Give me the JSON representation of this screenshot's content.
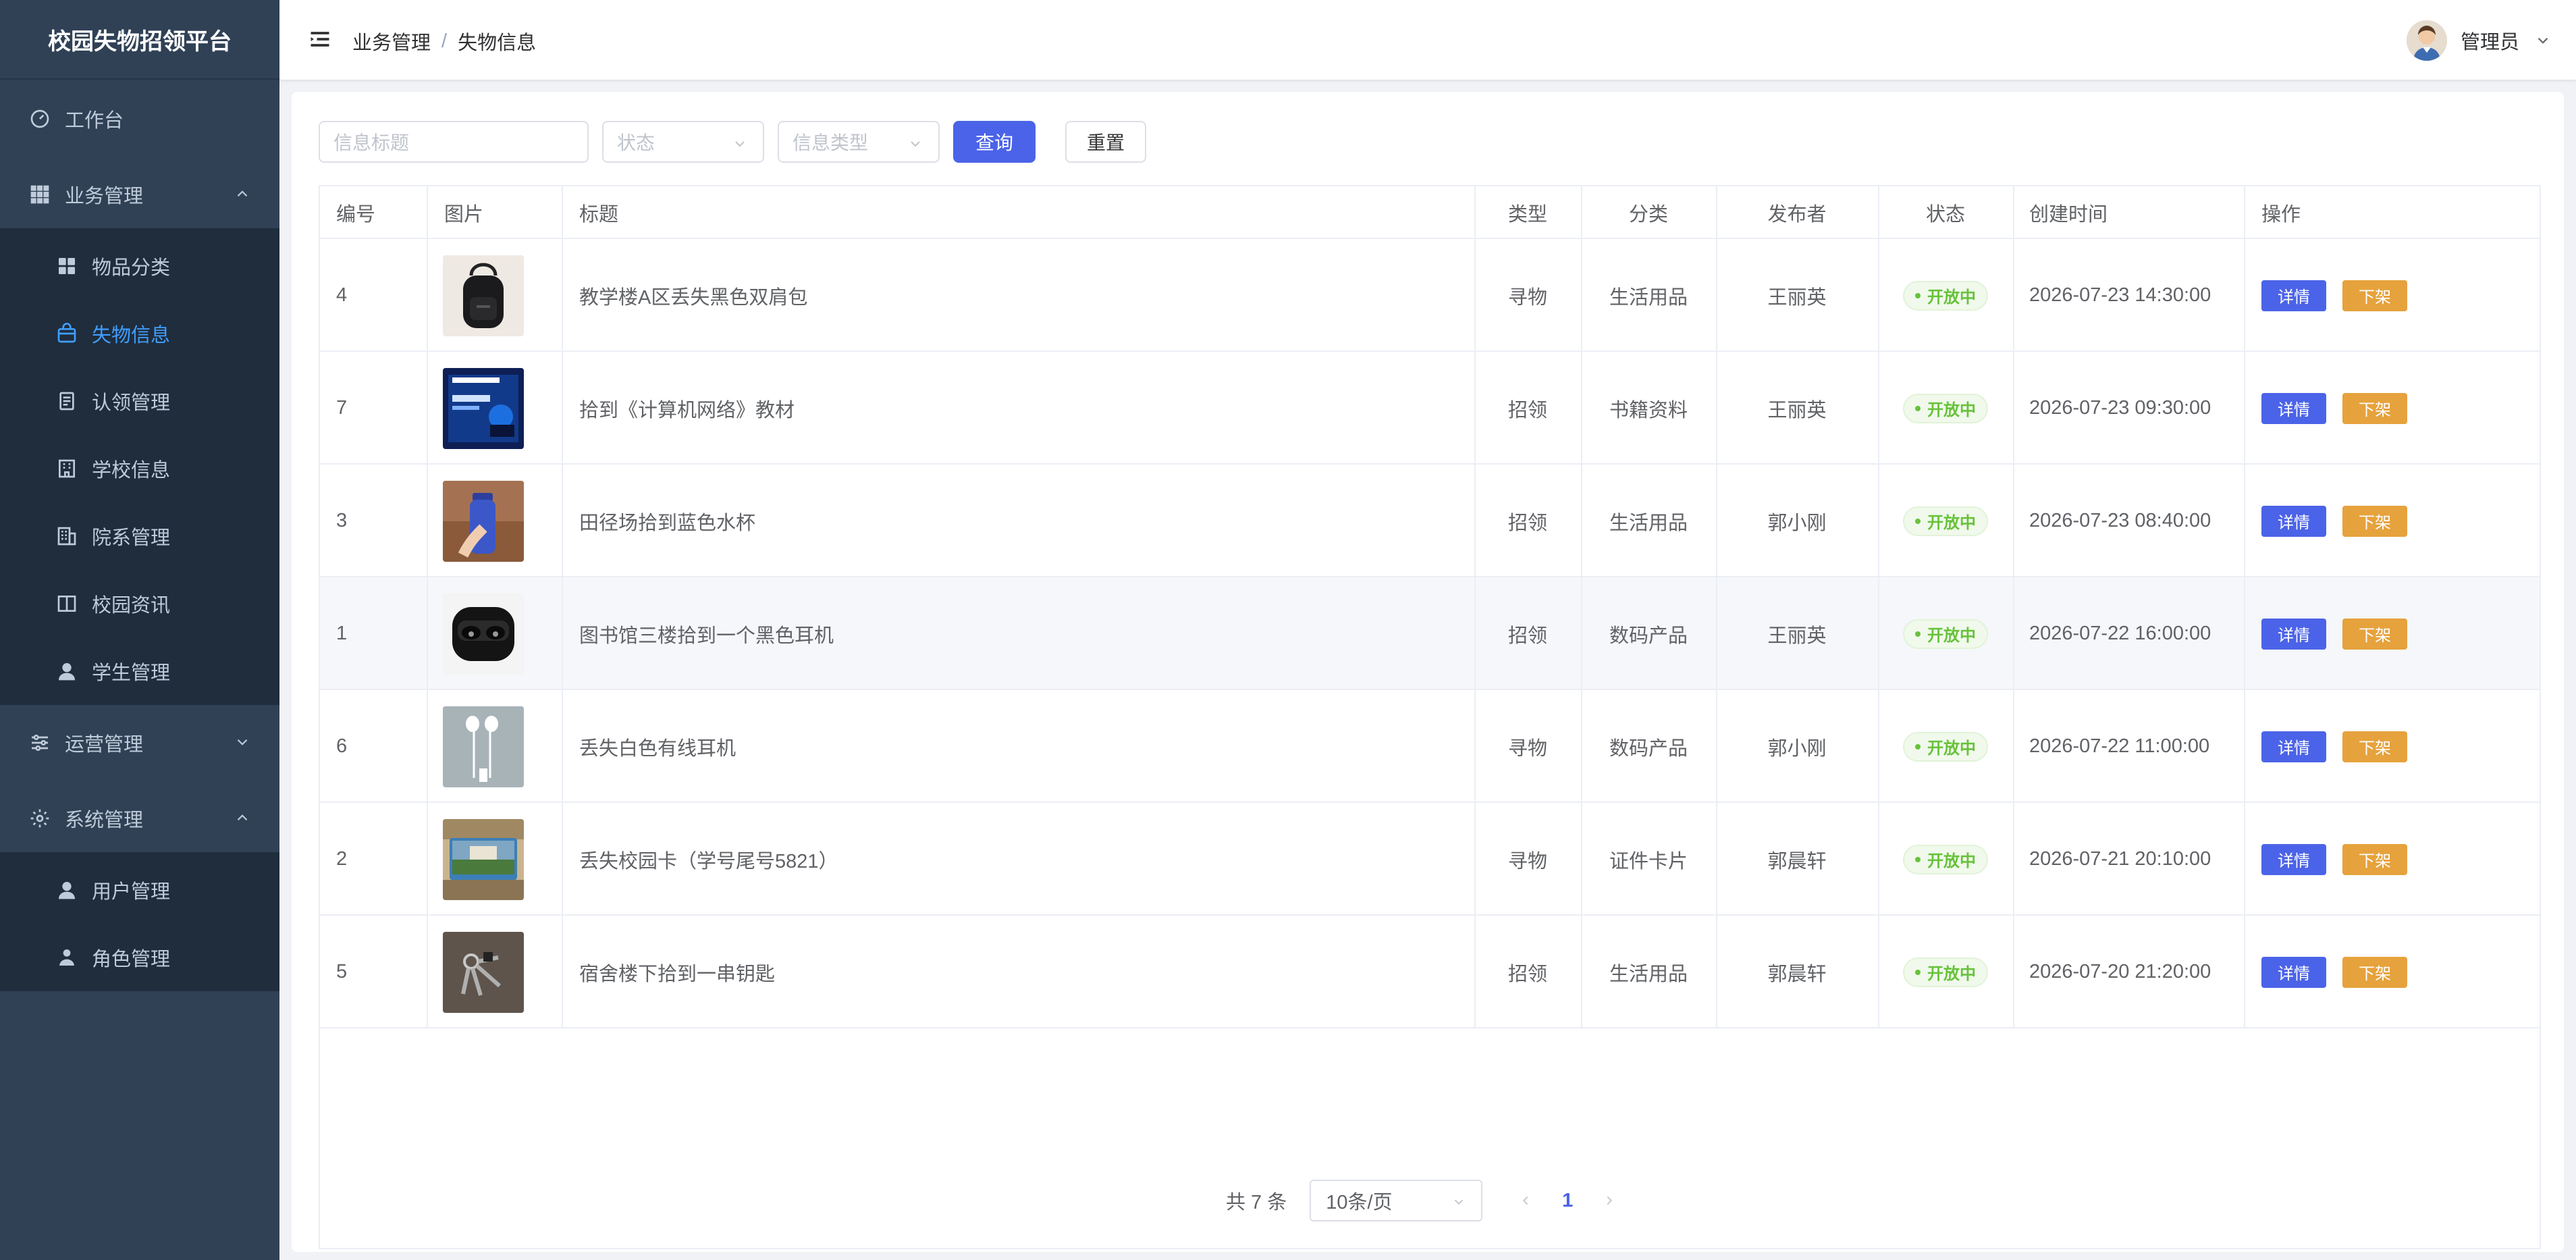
{
  "app": {
    "title": "校园失物招领平台"
  },
  "sidebar": {
    "items": [
      {
        "label": "工作台",
        "icon": "dashboard-icon"
      },
      {
        "label": "业务管理",
        "icon": "grid-icon",
        "expanded": true
      },
      {
        "label": "物品分类",
        "icon": "category-icon"
      },
      {
        "label": "失物信息",
        "icon": "bag-icon",
        "active": true
      },
      {
        "label": "认领管理",
        "icon": "document-icon"
      },
      {
        "label": "学校信息",
        "icon": "building-icon"
      },
      {
        "label": "院系管理",
        "icon": "office-icon"
      },
      {
        "label": "校园资讯",
        "icon": "book-icon"
      },
      {
        "label": "学生管理",
        "icon": "user-icon"
      },
      {
        "label": "运营管理",
        "icon": "sliders-icon",
        "expanded": false
      },
      {
        "label": "系统管理",
        "icon": "gear-icon",
        "expanded": true
      },
      {
        "label": "用户管理",
        "icon": "user-icon"
      },
      {
        "label": "角色管理",
        "icon": "user-role-icon"
      }
    ]
  },
  "header": {
    "breadcrumb": [
      "业务管理",
      "失物信息"
    ],
    "separator": "/",
    "user": "管理员"
  },
  "search": {
    "title_placeholder": "信息标题",
    "status_placeholder": "状态",
    "type_placeholder": "信息类型",
    "query_label": "查询",
    "reset_label": "重置"
  },
  "table": {
    "headers": [
      "编号",
      "图片",
      "标题",
      "类型",
      "分类",
      "发布者",
      "状态",
      "创建时间",
      "操作"
    ],
    "rows": [
      {
        "id": "4",
        "title": "教学楼A区丢失黑色双肩包",
        "type": "寻物",
        "category": "生活用品",
        "publisher": "王丽英",
        "status": "开放中",
        "created": "2026-07-23 14:30:00",
        "thumb": "backpack"
      },
      {
        "id": "7",
        "title": "拾到《计算机网络》教材",
        "type": "招领",
        "category": "书籍资料",
        "publisher": "王丽英",
        "status": "开放中",
        "created": "2026-07-23 09:30:00",
        "thumb": "book"
      },
      {
        "id": "3",
        "title": "田径场拾到蓝色水杯",
        "type": "招领",
        "category": "生活用品",
        "publisher": "郭小刚",
        "status": "开放中",
        "created": "2026-07-23 08:40:00",
        "thumb": "bottle"
      },
      {
        "id": "1",
        "title": "图书馆三楼拾到一个黑色耳机",
        "type": "招领",
        "category": "数码产品",
        "publisher": "王丽英",
        "status": "开放中",
        "created": "2026-07-22 16:00:00",
        "thumb": "earbuds"
      },
      {
        "id": "6",
        "title": "丢失白色有线耳机",
        "type": "寻物",
        "category": "数码产品",
        "publisher": "郭小刚",
        "status": "开放中",
        "created": "2026-07-22 11:00:00",
        "thumb": "wired"
      },
      {
        "id": "2",
        "title": "丢失校园卡（学号尾号5821）",
        "type": "寻物",
        "category": "证件卡片",
        "publisher": "郭晨轩",
        "status": "开放中",
        "created": "2026-07-21 20:10:00",
        "thumb": "card"
      },
      {
        "id": "5",
        "title": "宿舍楼下拾到一串钥匙",
        "type": "招领",
        "category": "生活用品",
        "publisher": "郭晨轩",
        "status": "开放中",
        "created": "2026-07-20 21:20:00",
        "thumb": "keys"
      }
    ],
    "actions": {
      "detail": "详情",
      "off": "下架"
    }
  },
  "pagination": {
    "total_text": "共 7 条",
    "page_size": "10条/页",
    "current_page": "1"
  },
  "colors": {
    "sidebar_bg": "#304156",
    "accent": "#4b63e8",
    "warning": "#e6a23c",
    "success": "#67c23a"
  }
}
